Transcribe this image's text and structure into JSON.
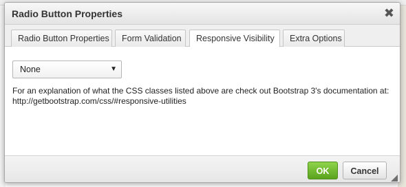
{
  "dialog": {
    "title": "Radio Button Properties",
    "close_glyph": "✖"
  },
  "tabs": [
    {
      "label": "Radio Button Properties",
      "active": false
    },
    {
      "label": "Form Validation",
      "active": false
    },
    {
      "label": "Responsive Visibility",
      "active": true
    },
    {
      "label": "Extra Options",
      "active": false
    }
  ],
  "content": {
    "visibility_select": {
      "value": "None",
      "arrow": "▼"
    },
    "help_text": "For an explanation of what the CSS classes listed above are check out Bootstrap 3's documentation at: http://getbootstrap.com/css/#responsive-utilities"
  },
  "footer": {
    "ok_label": "OK",
    "cancel_label": "Cancel"
  },
  "colors": {
    "ok_button": "#6cba2a",
    "title_text": "#333333"
  }
}
